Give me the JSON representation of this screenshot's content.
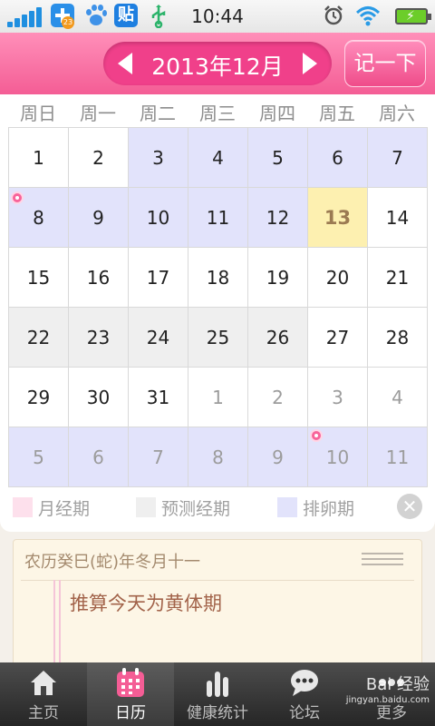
{
  "status_bar": {
    "time": "10:44",
    "badge_count": "23",
    "tieba_glyph": "贴",
    "icons": [
      "signal-icon",
      "app-plus-icon",
      "baidu-paw-icon",
      "tieba-icon",
      "usb-icon",
      "alarm-icon",
      "wifi-icon",
      "battery-charging-icon"
    ]
  },
  "header": {
    "month_title": "2013年12月",
    "record_button": "记一下",
    "prev_icon": "chevron-left-icon",
    "next_icon": "chevron-right-icon"
  },
  "calendar": {
    "weekdays": [
      "周日",
      "周一",
      "周二",
      "周三",
      "周四",
      "周五",
      "周六"
    ],
    "weeks": [
      [
        {
          "d": "1",
          "t": ""
        },
        {
          "d": "2",
          "t": ""
        },
        {
          "d": "3",
          "t": "ovu"
        },
        {
          "d": "4",
          "t": "ovu"
        },
        {
          "d": "5",
          "t": "ovu"
        },
        {
          "d": "6",
          "t": "ovu"
        },
        {
          "d": "7",
          "t": "ovu"
        }
      ],
      [
        {
          "d": "8",
          "t": "ovu",
          "dot": true
        },
        {
          "d": "9",
          "t": "ovu"
        },
        {
          "d": "10",
          "t": "ovu"
        },
        {
          "d": "11",
          "t": "ovu"
        },
        {
          "d": "12",
          "t": "ovu"
        },
        {
          "d": "13",
          "t": "today"
        },
        {
          "d": "14",
          "t": ""
        }
      ],
      [
        {
          "d": "15",
          "t": ""
        },
        {
          "d": "16",
          "t": ""
        },
        {
          "d": "17",
          "t": ""
        },
        {
          "d": "18",
          "t": ""
        },
        {
          "d": "19",
          "t": ""
        },
        {
          "d": "20",
          "t": ""
        },
        {
          "d": "21",
          "t": ""
        }
      ],
      [
        {
          "d": "22",
          "t": "pred"
        },
        {
          "d": "23",
          "t": "pred"
        },
        {
          "d": "24",
          "t": "pred"
        },
        {
          "d": "25",
          "t": "pred"
        },
        {
          "d": "26",
          "t": "pred"
        },
        {
          "d": "27",
          "t": ""
        },
        {
          "d": "28",
          "t": ""
        }
      ],
      [
        {
          "d": "29",
          "t": ""
        },
        {
          "d": "30",
          "t": ""
        },
        {
          "d": "31",
          "t": ""
        },
        {
          "d": "1",
          "t": "other"
        },
        {
          "d": "2",
          "t": "other"
        },
        {
          "d": "3",
          "t": "other"
        },
        {
          "d": "4",
          "t": "other"
        }
      ],
      [
        {
          "d": "5",
          "t": "other ovu"
        },
        {
          "d": "6",
          "t": "other ovu"
        },
        {
          "d": "7",
          "t": "other ovu"
        },
        {
          "d": "8",
          "t": "other ovu"
        },
        {
          "d": "9",
          "t": "other ovu"
        },
        {
          "d": "10",
          "t": "other ovu",
          "dot": true
        },
        {
          "d": "11",
          "t": "other ovu"
        }
      ]
    ],
    "colors": {
      "period": "#fde0ec",
      "predicted": "#efefef",
      "ovulation": "#e2e3fb",
      "today": "#fdf0b0",
      "accent": "#f45d95"
    }
  },
  "legend": {
    "period": "月经期",
    "predicted": "预测经期",
    "ovulation": "排卵期",
    "close_icon": "close-icon"
  },
  "note": {
    "lunar_date": "农历癸巳(蛇)年冬月十一",
    "status": "推算今天为黄体期",
    "menu_icon": "menu-lines-icon"
  },
  "tabs": [
    {
      "label": "主页",
      "icon": "home-icon",
      "active": false
    },
    {
      "label": "日历",
      "icon": "calendar-icon",
      "active": true
    },
    {
      "label": "健康统计",
      "icon": "bar-chart-icon",
      "active": false
    },
    {
      "label": "论坛",
      "icon": "chat-bubble-icon",
      "active": false
    },
    {
      "label": "更多",
      "icon": "more-icon",
      "active": false
    }
  ],
  "watermark": {
    "text": "Bai 经验",
    "sub": "jingyan.baidu.com"
  }
}
